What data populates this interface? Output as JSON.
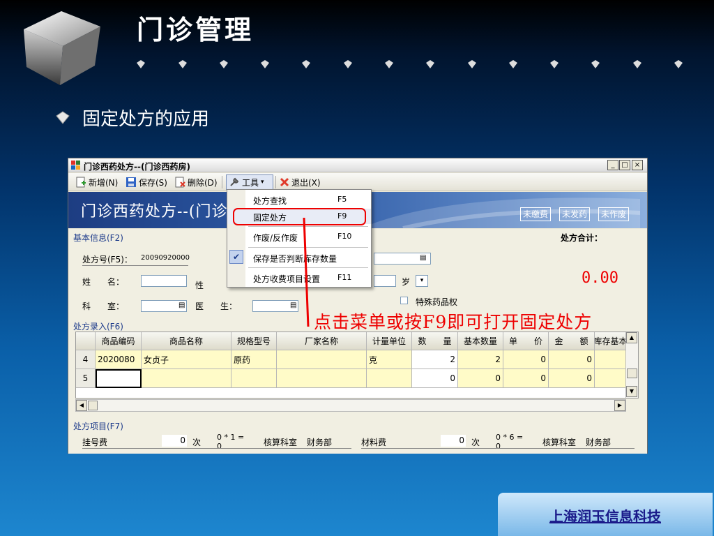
{
  "slide": {
    "title": "门诊管理",
    "bullet": "固定处方的应用",
    "footer_company": "上海润玉信息科技"
  },
  "window": {
    "title": "门诊西药处方--(门诊西药房)",
    "min_glyph": "_",
    "max_glyph": "□",
    "close_glyph": "×"
  },
  "toolbar": {
    "new_label": "新增(N)",
    "save_label": "保存(S)",
    "delete_label": "删除(D)",
    "tools_label": "工具",
    "exit_label": "退出(X)"
  },
  "banner": {
    "title": "门诊西药处方--(门诊",
    "status_unpaid": "未缴费",
    "status_undispensed": "未发药",
    "status_unvoided": "未作废"
  },
  "form": {
    "basic_info_label": "基本信息(F2)",
    "rx_total_label": "处方合计：",
    "rx_no_label": "处方号(F5)：",
    "rx_no_value": "20090920000",
    "name_label": "姓　　名：",
    "gender_label": "性",
    "dept_label": "科　　室：",
    "doctor_label": "医　　生：",
    "age_unit": "岁",
    "special_drug_label": "特殊药品权",
    "total_amount": "0.00",
    "rx_entry_label": "处方录入(F6)",
    "rx_items_label": "处方项目(F7)"
  },
  "annotation": "点击菜单或按F9即可打开固定处方",
  "grid": {
    "headers": [
      "",
      "商品编码",
      "商品名称",
      "规格型号",
      "厂家名称",
      "计量单位",
      "数　　量",
      "基本数量",
      "单　　价",
      "金　　额",
      "库存基本"
    ],
    "rows": [
      [
        "4",
        "2020080",
        "女贞子",
        "原药",
        "",
        "克",
        "2",
        "2",
        "0",
        "0",
        ""
      ],
      [
        "5",
        "",
        "",
        "",
        "",
        "",
        "0",
        "0",
        "0",
        "0",
        ""
      ]
    ]
  },
  "fees": {
    "reg_fee_label": "挂号费",
    "reg_fee_value": "0",
    "times_label": "次",
    "reg_formula": "0 * 1 =",
    "reg_formula_result": "0",
    "audit_dept_label": "核算科室",
    "audit_dept_value": "财务部",
    "material_fee_label": "材料费",
    "material_fee_value": "0",
    "material_formula": "0 * 6 =",
    "material_formula_result": "0",
    "audit_dept_label2": "核算科室",
    "audit_dept_value2": "财务部"
  },
  "menu": {
    "items": [
      {
        "label": "处方查找",
        "key": "F5"
      },
      {
        "label": "固定处方",
        "key": "F9"
      },
      {
        "label": "作废/反作废",
        "key": "F10"
      },
      {
        "label": "保存是否判断库存数量",
        "key": ""
      },
      {
        "label": "处方收费项目设置",
        "key": "F11"
      }
    ]
  },
  "colors": {
    "highlight_red": "#e00000",
    "banner_blue": "#2d5aa5",
    "grid_yellow": "#fffbc8"
  }
}
